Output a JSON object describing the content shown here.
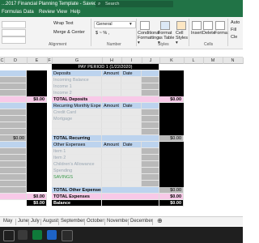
{
  "window": {
    "title": "...2017 Financial Planning Template - Saved ▾",
    "search_placeholder": "Search"
  },
  "ribbon_tabs": [
    "Formulas",
    "Data",
    "Review",
    "View",
    "Help"
  ],
  "ribbon": {
    "font_name": "General",
    "wrap_text": "Wrap Text",
    "merge_center": "Merge & Center",
    "currency": "$ ~ % ,",
    "conditional_formatting": "Conditional Formatting ▾",
    "format_as_table": "Format as Table ▾",
    "cell_styles": "Cell Styles ▾",
    "insert": "Insert",
    "delete": "Delete",
    "format": "Format",
    "autosum": "Auto",
    "fill": "Fill",
    "clear": "Cle",
    "group_alignment": "Alignment",
    "group_number": "Number",
    "group_styles": "Styles",
    "group_cells": "Cells"
  },
  "columns": [
    "C",
    "D",
    "E",
    "F",
    "G",
    "H",
    "I",
    "J",
    "K",
    "L",
    "M",
    "N"
  ],
  "sheet": {
    "pay_period": "PAY PERIOD 1 (1/22/2020)",
    "deposits_header": "Deposits",
    "amount": "Amount",
    "date": "Date",
    "deposits_items": [
      "Incoming Balance",
      "Income 1",
      "Income 2"
    ],
    "total_deposits": "TOTAL Deposits",
    "total_deposits_value": "$0.00",
    "recurring_header": "Recurring Monthly Expense",
    "recurring_items": [
      "Credit Card",
      "Mortgage"
    ],
    "total_recurring": "TOTAL Recurring",
    "total_recurring_value": "$0.00",
    "other_header": "Other Expenses",
    "other_items": [
      "Item 1",
      "Item 2",
      "Children's Allowance",
      "Spending",
      "SAVINGS"
    ],
    "total_other": "TOTAL Other Expenses",
    "total_other_value": "$0.00",
    "total_expenses": "TOTAL Expenses",
    "total_expenses_value": "$0.00",
    "balance": "Balance",
    "balance_value": "$0.00",
    "left_values": {
      "r1": "$0.00",
      "r2": "$0.00",
      "r3": "$0.00",
      "r4": "$0.00",
      "r5": "$0.00"
    }
  },
  "sheet_tabs": [
    "May",
    "June",
    "July",
    "August",
    "September",
    "October",
    "November",
    "December"
  ],
  "taskbar": {
    "autohide": "Auto"
  }
}
